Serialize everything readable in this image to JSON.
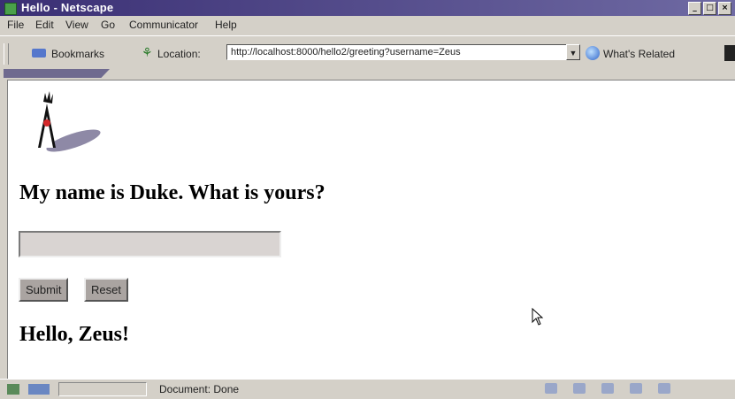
{
  "window": {
    "title": "Hello - Netscape"
  },
  "menu": [
    "File",
    "Edit",
    "View",
    "Go",
    "Communicator",
    "Help"
  ],
  "toolbar": {
    "bookmarks_label": "Bookmarks",
    "location_label": "Location:",
    "url": "http://localhost:8000/hello2/greeting?username=Zeus",
    "whats_related_label": "What's Related"
  },
  "page": {
    "heading": "My name is Duke. What is yours?",
    "name_input_value": "",
    "submit_label": "Submit",
    "reset_label": "Reset",
    "greeting": "Hello, Zeus!"
  },
  "status": {
    "text": "Document: Done"
  },
  "colors": {
    "title_bar": "#3a2f74",
    "chrome": "#d4d0c8",
    "page_bg": "#ffffff"
  }
}
